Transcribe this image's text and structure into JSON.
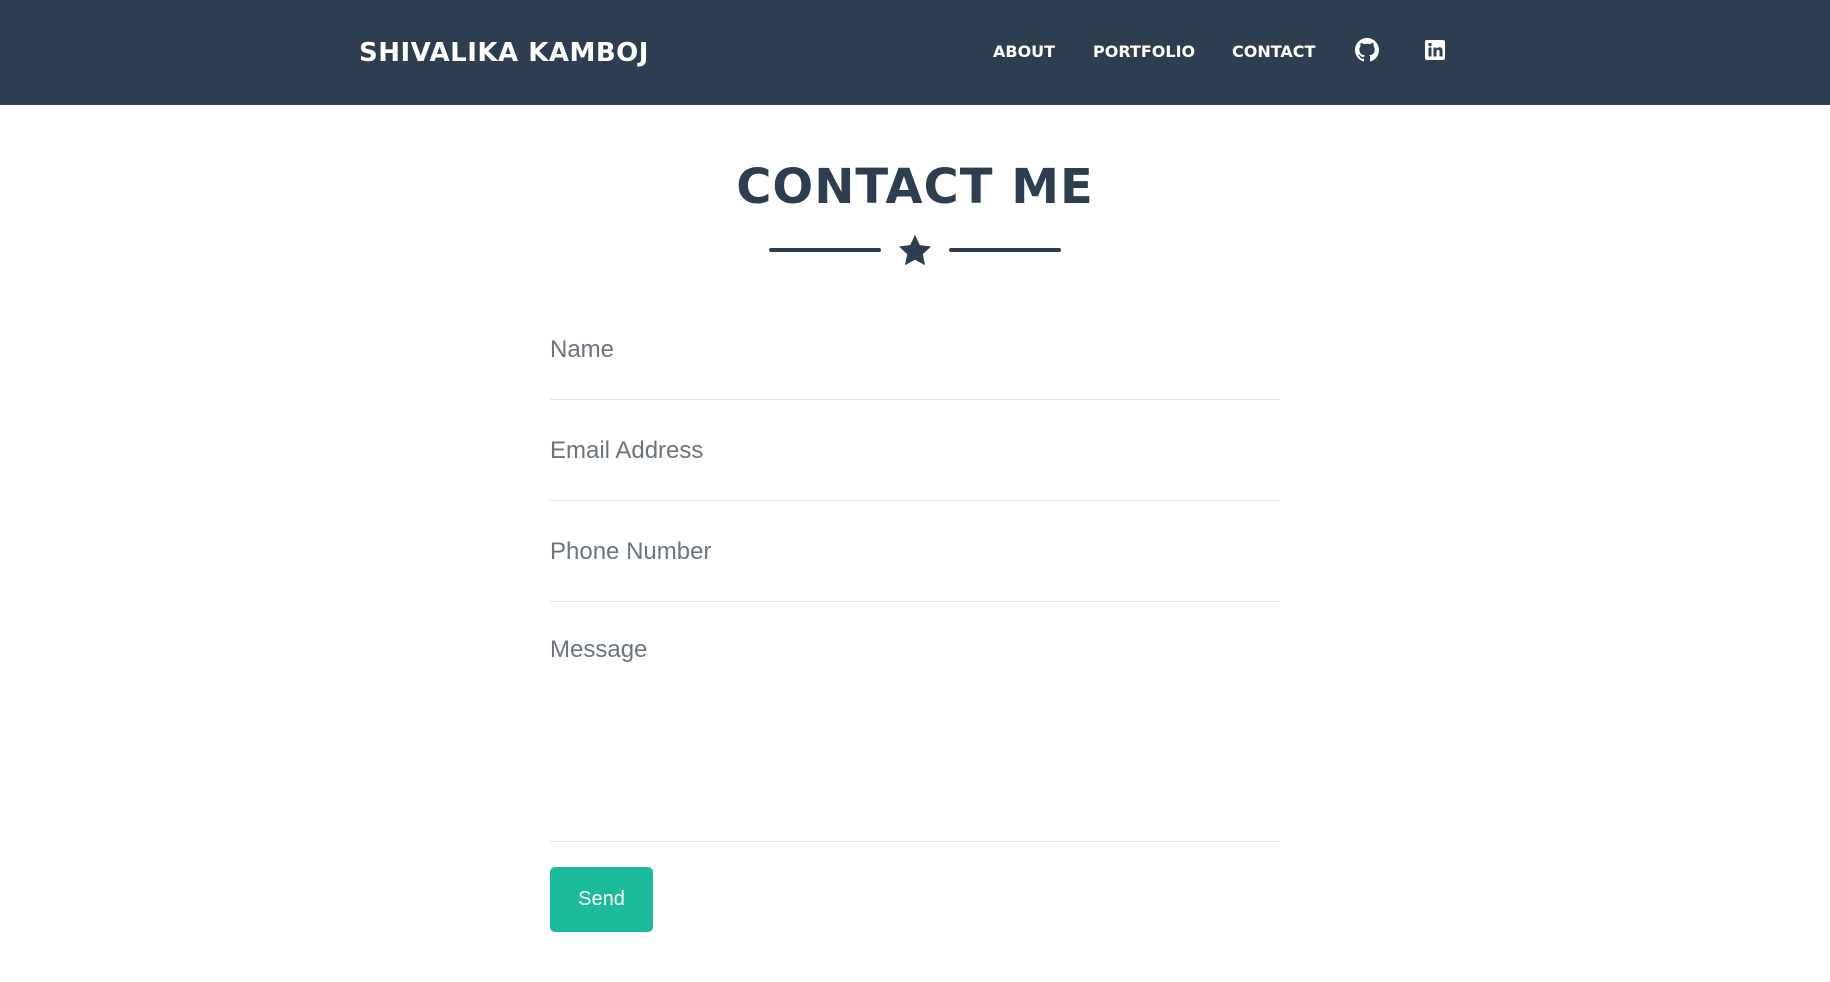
{
  "navbar": {
    "brand": "SHIVALIKA KAMBOJ",
    "links": [
      {
        "label": "ABOUT"
      },
      {
        "label": "PORTFOLIO"
      },
      {
        "label": "CONTACT"
      }
    ],
    "icons": [
      "github-icon",
      "linkedin-icon"
    ]
  },
  "contact": {
    "title": "CONTACT ME",
    "divider_icon": "star-icon",
    "fields": {
      "name": {
        "placeholder": "Name",
        "value": ""
      },
      "email": {
        "placeholder": "Email Address",
        "value": ""
      },
      "phone": {
        "placeholder": "Phone Number",
        "value": ""
      },
      "message": {
        "placeholder": "Message",
        "value": ""
      }
    },
    "send_label": "Send"
  },
  "colors": {
    "navbar_bg": "#2c3e50",
    "primary_text": "#2c3e50",
    "accent": "#1abc9c",
    "placeholder": "#6c757d"
  }
}
